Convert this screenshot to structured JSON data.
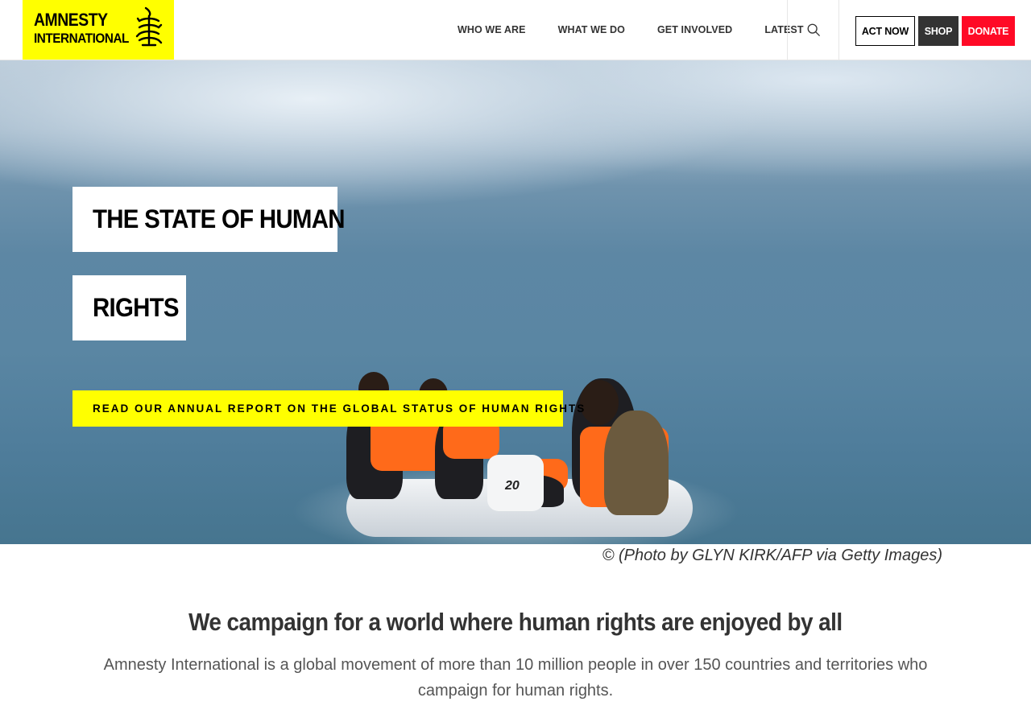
{
  "header": {
    "logo": {
      "line1": "AMNESTY",
      "line2": "INTERNATIONAL",
      "icon": "candle-in-barbed-wire-icon",
      "color": "#ffff00"
    },
    "nav": [
      "WHO WE ARE",
      "WHAT WE DO",
      "GET INVOLVED",
      "LATEST"
    ],
    "search_icon": "search-icon",
    "buttons": {
      "act_now": "ACT NOW",
      "shop": "SHOP",
      "donate": "DONATE"
    },
    "colors": {
      "donate": "#ff0a26",
      "shop": "#333333"
    }
  },
  "hero": {
    "title_line1": "THE STATE OF HUMAN",
    "title_line2": "RIGHTS",
    "cta": "READ OUR ANNUAL REPORT ON THE GLOBAL STATUS OF HUMAN RIGHTS",
    "boat_number": "20",
    "caption": "© (Photo by GLYN KIRK/AFP via Getty Images)",
    "accent": "#ffff00"
  },
  "main": {
    "headline": "We campaign for a world where human rights are enjoyed by all",
    "intro": "Amnesty International is a global movement of more than 10 million people in over 150 countries and territories who campaign for human rights."
  }
}
